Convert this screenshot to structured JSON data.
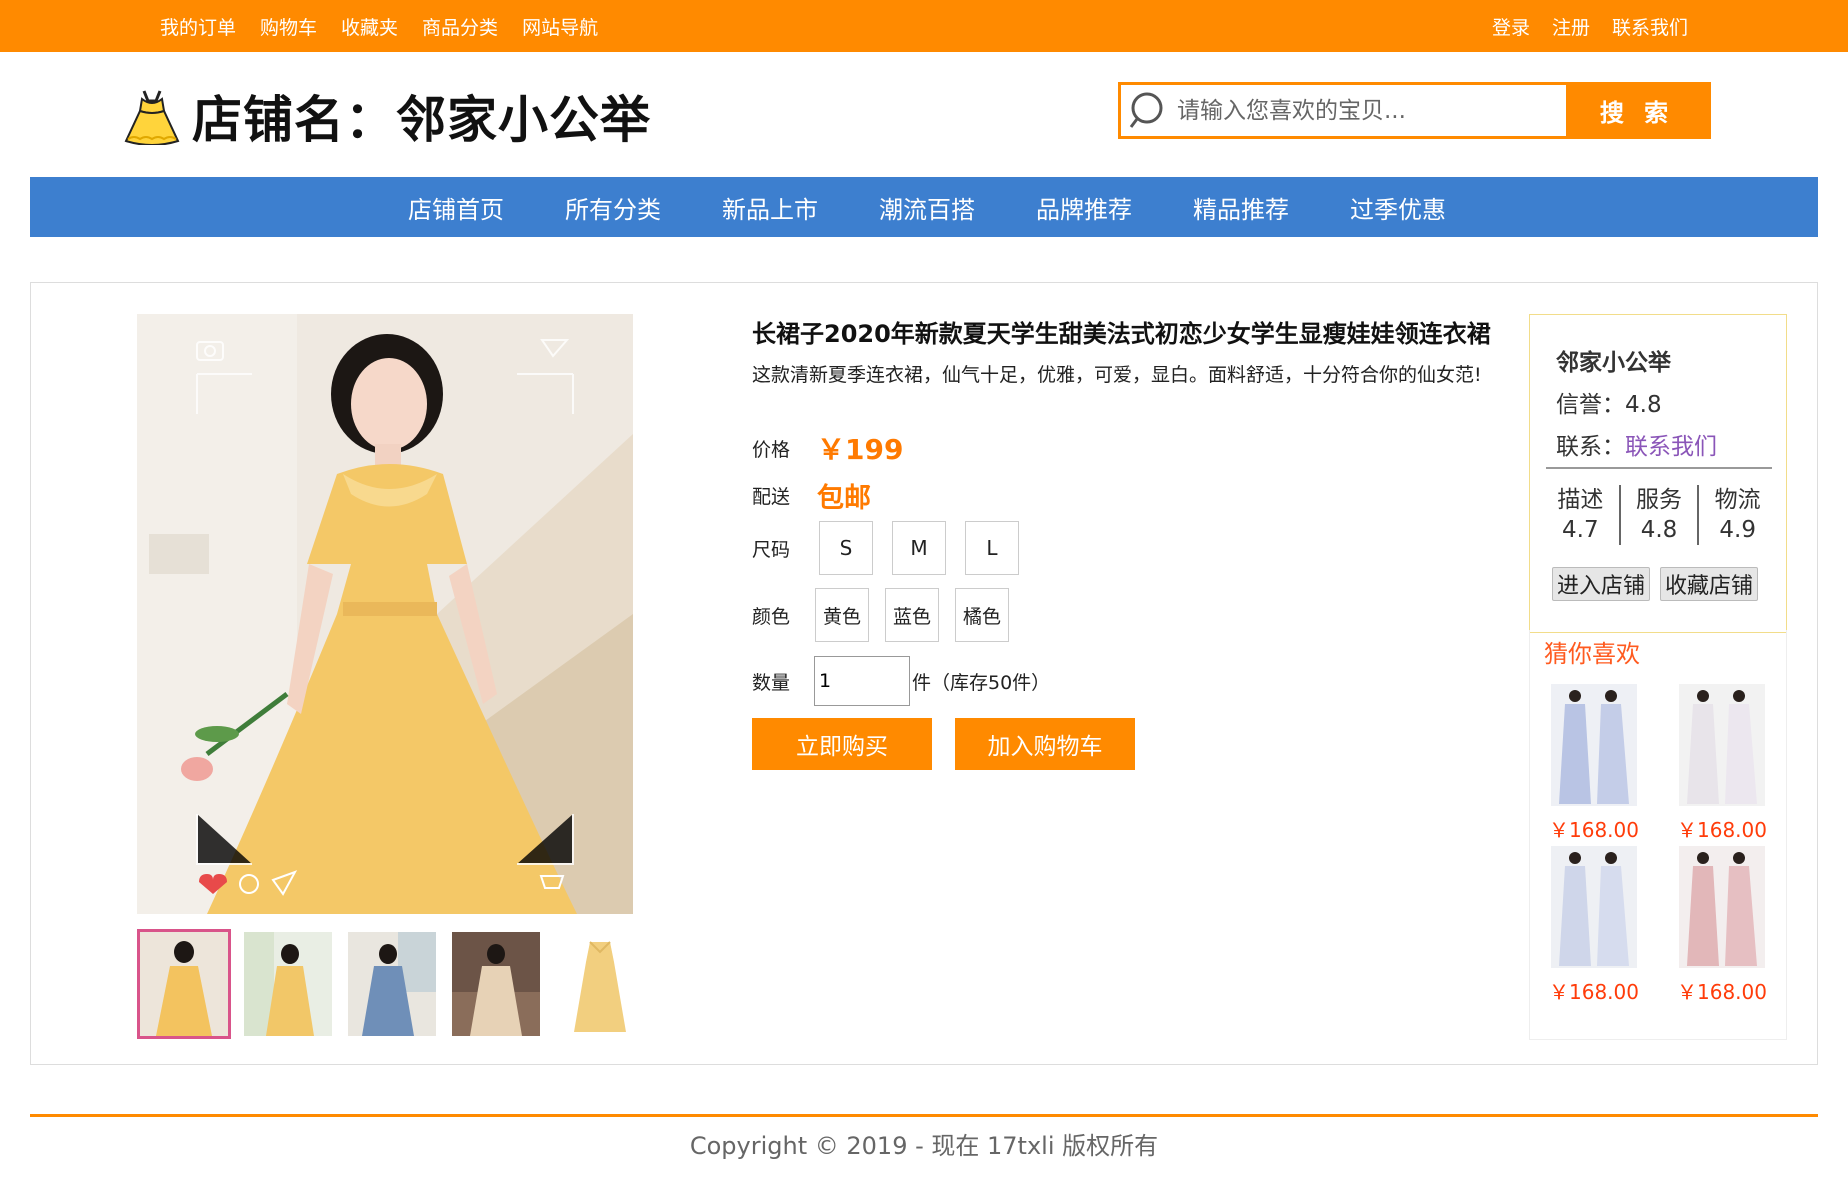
{
  "topbar": {
    "left": [
      "我的订单",
      "购物车",
      "收藏夹",
      "商品分类",
      "网站导航"
    ],
    "right": [
      "登录",
      "注册",
      "联系我们"
    ]
  },
  "header": {
    "shop_title": "店铺名：邻家小公举",
    "search_placeholder": "请输入您喜欢的宝贝...",
    "search_button": "搜 索"
  },
  "nav": [
    "店铺首页",
    "所有分类",
    "新品上市",
    "潮流百搭",
    "品牌推荐",
    "精品推荐",
    "过季优惠"
  ],
  "product": {
    "title": "长裙子2020年新款夏天学生甜美法式初恋少女学生显瘦娃娃领连衣裙",
    "description": "这款清新夏季连衣裙，仙气十足，优雅，可爱，显白。面料舒适，十分符合你的仙女范!",
    "price_label": "价格",
    "price": "￥199",
    "shipping_label": "配送",
    "shipping": "包邮",
    "size_label": "尺码",
    "sizes": [
      "S",
      "M",
      "L"
    ],
    "color_label": "颜色",
    "colors": [
      "黄色",
      "蓝色",
      "橘色"
    ],
    "qty_label": "数量",
    "qty_value": "1",
    "stock_text": "件（库存50件）",
    "buy_now": "立即购买",
    "add_cart": "加入购物车"
  },
  "shop": {
    "name": "邻家小公举",
    "credit": "信誉：4.8",
    "contact_label": "联系：",
    "contact_link": "联系我们",
    "stats": [
      {
        "label": "描述",
        "value": "4.7"
      },
      {
        "label": "服务",
        "value": "4.8"
      },
      {
        "label": "物流",
        "value": "4.9"
      }
    ],
    "enter_button": "进入店铺",
    "fav_button": "收藏店铺"
  },
  "guess": {
    "title": "猜你喜欢",
    "items": [
      {
        "price": "￥168.00"
      },
      {
        "price": "￥168.00"
      },
      {
        "price": "￥168.00"
      },
      {
        "price": "￥168.00"
      }
    ]
  },
  "footer": {
    "copyright": "Copyright © 2019 - 现在 17txli 版权所有"
  },
  "colors": {
    "accent": "#ff8a00",
    "nav": "#3d7fcf",
    "price": "#ff7a00",
    "link": "#8a55b8"
  }
}
